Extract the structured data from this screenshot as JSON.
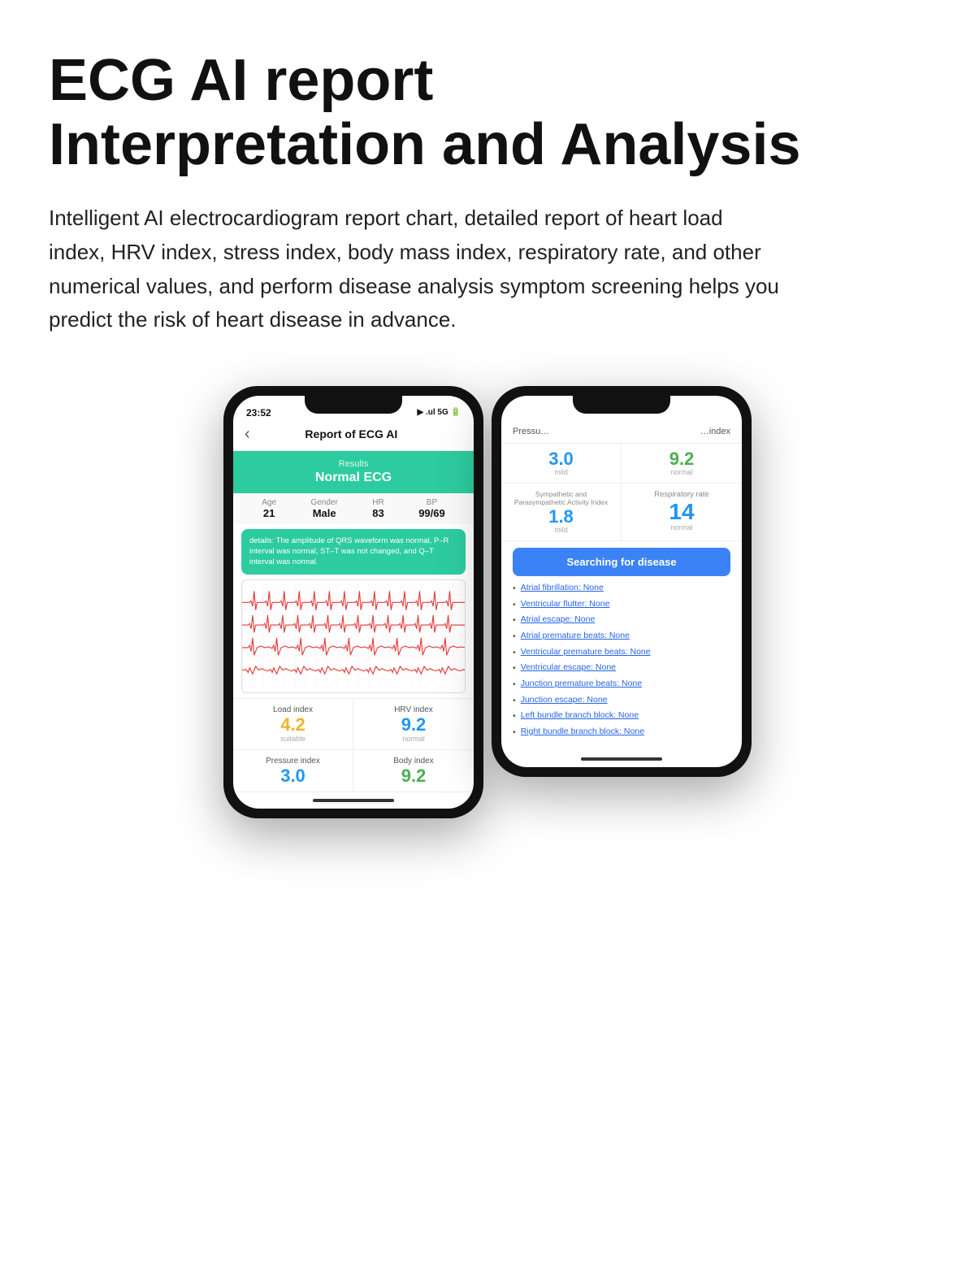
{
  "header": {
    "title_line1": "ECG AI report",
    "title_line2": "Interpretation and Analysis",
    "description": "Intelligent AI electrocardiogram report chart, detailed report of heart load index, HRV index, stress index, body mass index, respiratory rate, and other numerical values, and perform disease analysis symptom screening helps you predict the risk of heart disease in advance."
  },
  "phone1": {
    "status_time": "23:52",
    "status_signal": "▶",
    "status_network": "5G",
    "back_label": "‹",
    "screen_title": "Report of ECG AI",
    "results_label": "Results",
    "results_value": "Normal ECG",
    "patient": {
      "age_label": "Age",
      "age_value": "21",
      "gender_label": "Gender",
      "gender_value": "Male",
      "hr_label": "HR",
      "hr_value": "83",
      "bp_label": "BP",
      "bp_value": "99/69"
    },
    "details_text": "details: The amplitude of QRS waveform was normal, P–R interval was normal, ST–T was not changed, and Q–T interval was normal.",
    "indices": [
      {
        "label": "Load index",
        "value": "4.2",
        "color": "yellow",
        "sublabel": "suitable"
      },
      {
        "label": "HRV index",
        "value": "9.2",
        "color": "blue",
        "sublabel": "normal"
      },
      {
        "label": "Pressure index",
        "value": "3.0",
        "color": "blue",
        "sublabel": ""
      },
      {
        "label": "Body index",
        "value": "9.2",
        "color": "green",
        "sublabel": ""
      }
    ]
  },
  "phone2": {
    "header_left": "Pressu…",
    "header_right": "…index",
    "vals": [
      {
        "value": "3.0",
        "color": "blue",
        "label": "",
        "sublabel": "mild"
      },
      {
        "value": "9.2",
        "color": "green",
        "label": "",
        "sublabel": "normal"
      }
    ],
    "symp_label": "Sympathetic and\nParasympathetic Activity Index",
    "symp_value": "1.8",
    "symp_sublabel": "mild",
    "resp_label": "Respiratory rate",
    "resp_value": "14",
    "resp_sublabel": "normal",
    "search_btn": "Searching for disease",
    "diseases": [
      {
        "name": "Atrial fibrillation:",
        "result": "None"
      },
      {
        "name": "Ventricular flutter:",
        "result": "None"
      },
      {
        "name": "Atrial escape:",
        "result": "None"
      },
      {
        "name": "Atrial premature beats:",
        "result": "None"
      },
      {
        "name": "Ventricular premature beats:",
        "result": "None"
      },
      {
        "name": "Ventricular escape:",
        "result": "None"
      },
      {
        "name": "Junction premature beats:",
        "result": "None"
      },
      {
        "name": "Junction escape:",
        "result": "None"
      },
      {
        "name": "Left bundle branch block:",
        "result": "None"
      },
      {
        "name": "Right bundle branch block:",
        "result": "None"
      }
    ]
  }
}
